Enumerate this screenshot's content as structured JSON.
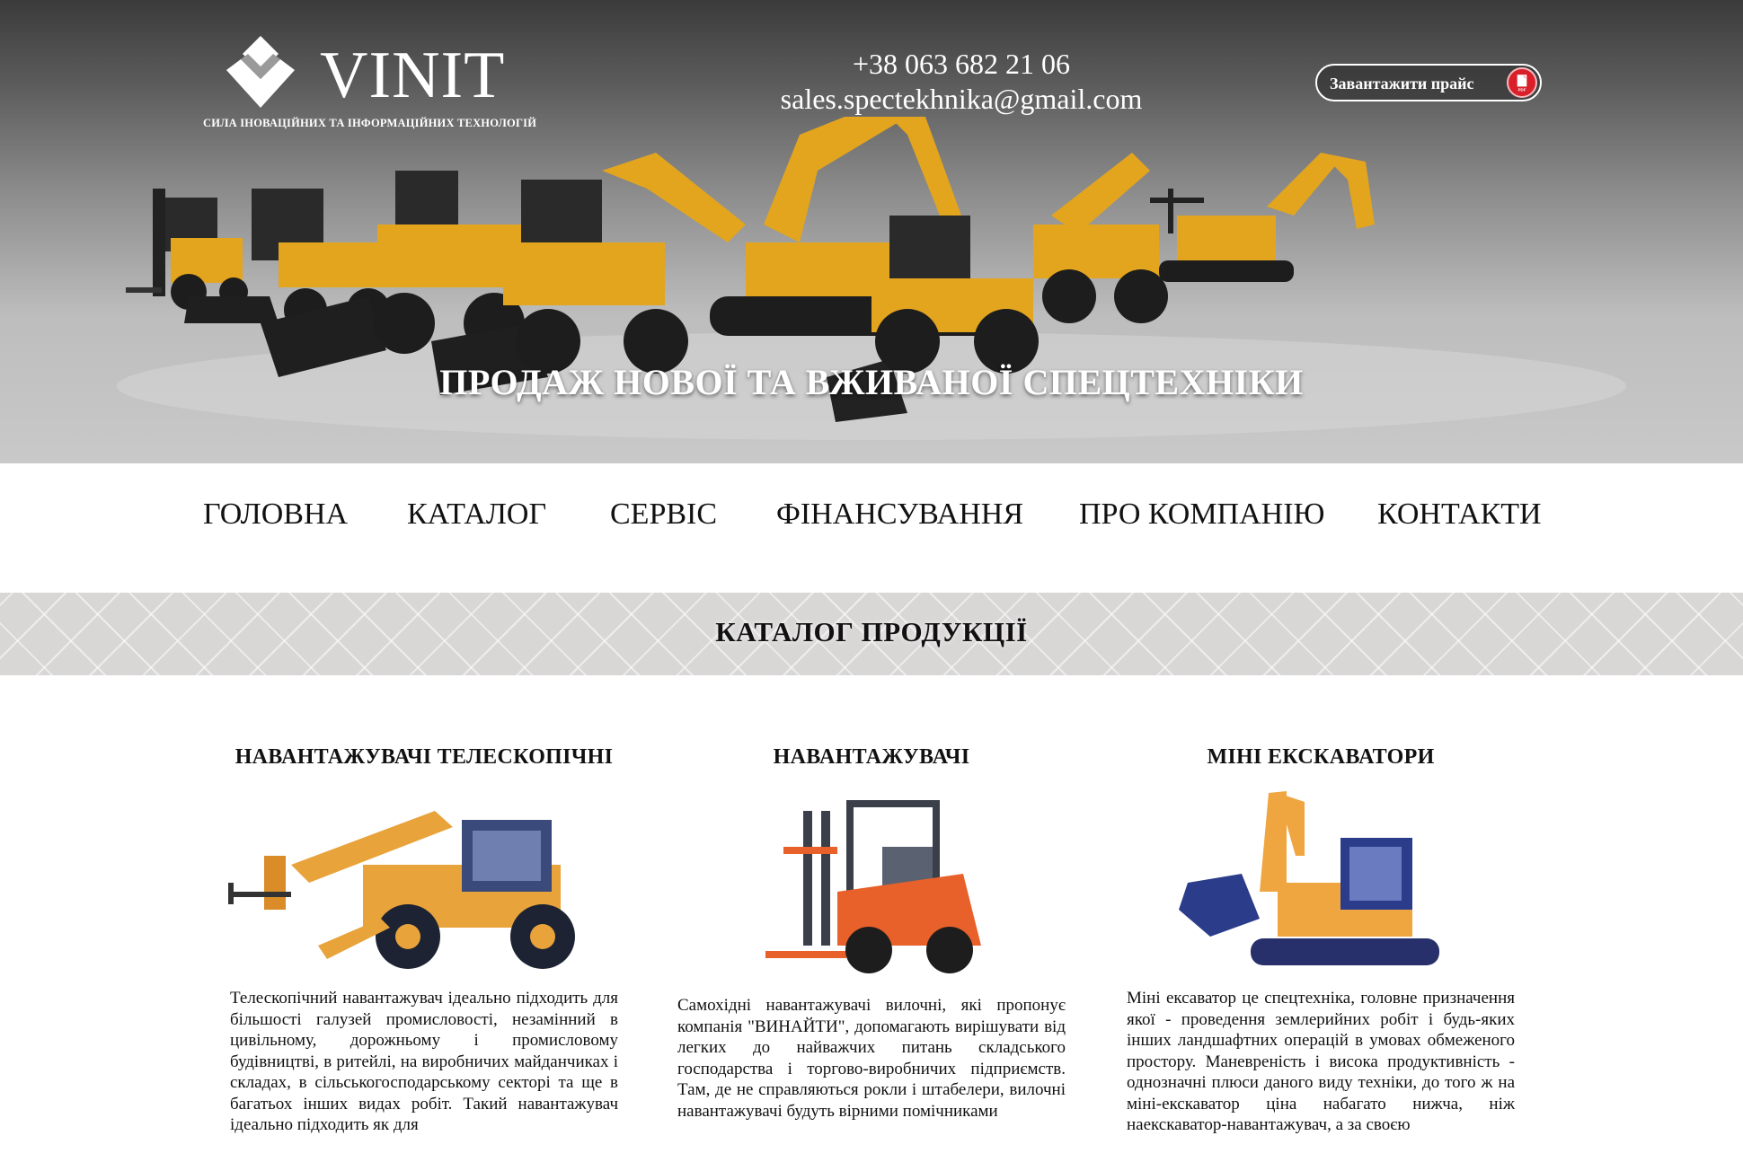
{
  "header": {
    "logo_text": "VINIT",
    "logo_slogan": "СИЛА ІНОВАЦІЙНИХ ТА ІНФОРМАЦІЙНИХ ТЕХНОЛОГІЙ",
    "phone": "+38 063 682 21 06",
    "email": "sales.spectekhnika@gmail.com",
    "price_button_label": "Завантажити прайс",
    "pdf_icon_label": "PDF",
    "hero_title": "ПРОДАЖ НОВОЇ ТА ВЖИВАНОЇ СПЕЦТЕХНІКИ"
  },
  "nav": {
    "items": [
      "ГОЛОВНА",
      "КАТАЛОГ",
      "СЕРВІС",
      "ФІНАНСУВАННЯ",
      "ПРО КОМПАНІЮ",
      "КОНТАКТИ"
    ]
  },
  "catalog": {
    "title": "КАТАЛОГ ПРОДУКЦІЇ",
    "products": [
      {
        "title": "НАВАНТАЖУВАЧІ ТЕЛЕСКОПІЧНІ",
        "image_icon": "telehandler-icon",
        "description": "Телескопічний навантажувач ідеально підходить для більшості галузей промисловості, незамінний в цивільному, дорожньому і промисловому будівництві, в ритейлі, на виробничих майданчиках і складах, в сільськогосподарському секторі та ще в багатьох інших видах робіт. Такий навантажувач ідеально підходить як для"
      },
      {
        "title": "НАВАНТАЖУВАЧІ",
        "image_icon": "forklift-icon",
        "description": "Самохідні навантажувачі вилочні, які пропонує компанія \"ВИНАЙТИ\", допомагають вирішувати від легких до найважчих питань складського господарства і торгово-виробничих підприємств. Там, де не справляються рокли і штабелери, вилочні навантажувачі будуть вірними помічниками"
      },
      {
        "title": "МІНІ ЕКСКАВАТОРИ",
        "image_icon": "mini-excavator-icon",
        "description": "Міні ексаватор це спецтехніка, головне призначення якої - проведення землерийних робіт і будь-яких інших ландшафтних операцій в умовах обмеженого простору. Маневреність і висока продуктивність - однозначні плюси даного виду техніки, до того ж на міні-екскаватор ціна набагато нижча, ніж наекскаватор-навантажувач, а за своєю"
      }
    ]
  },
  "colors": {
    "machine_yellow": "#e3a51e",
    "forklift_orange": "#e8602a",
    "pdf_red": "#d9202a",
    "band_gray": "#d9d6d6"
  }
}
